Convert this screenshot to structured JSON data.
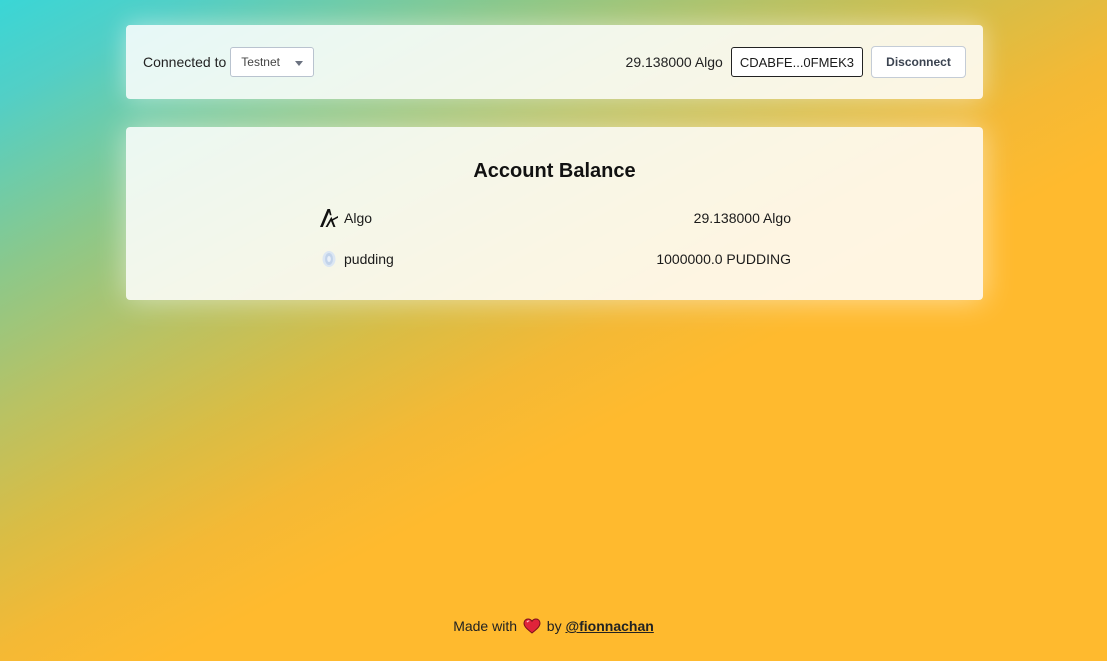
{
  "header": {
    "connected_label": "Connected to",
    "network_selected": "Testnet",
    "balance": "29.138000 Algo",
    "address": "CDABFE...0FMEK3",
    "disconnect_label": "Disconnect"
  },
  "account": {
    "title": "Account Balance",
    "assets": [
      {
        "icon": "algorand-logo-icon",
        "name": "Algo",
        "amount": "29.138000 Algo"
      },
      {
        "icon": "pudding-token-icon",
        "name": "pudding",
        "amount": "1000000.0 PUDDING"
      }
    ]
  },
  "footer": {
    "made_with": "Made with",
    "by": "by",
    "author_link": "@fionnachan",
    "heart_icon": "heart-icon"
  },
  "colors": {
    "gradient_teal": "#3ad6d6",
    "gradient_green": "#8cc88a",
    "gradient_amber": "#ffba2e",
    "card_bg": "#ffffff",
    "heart": "#e0243a"
  }
}
